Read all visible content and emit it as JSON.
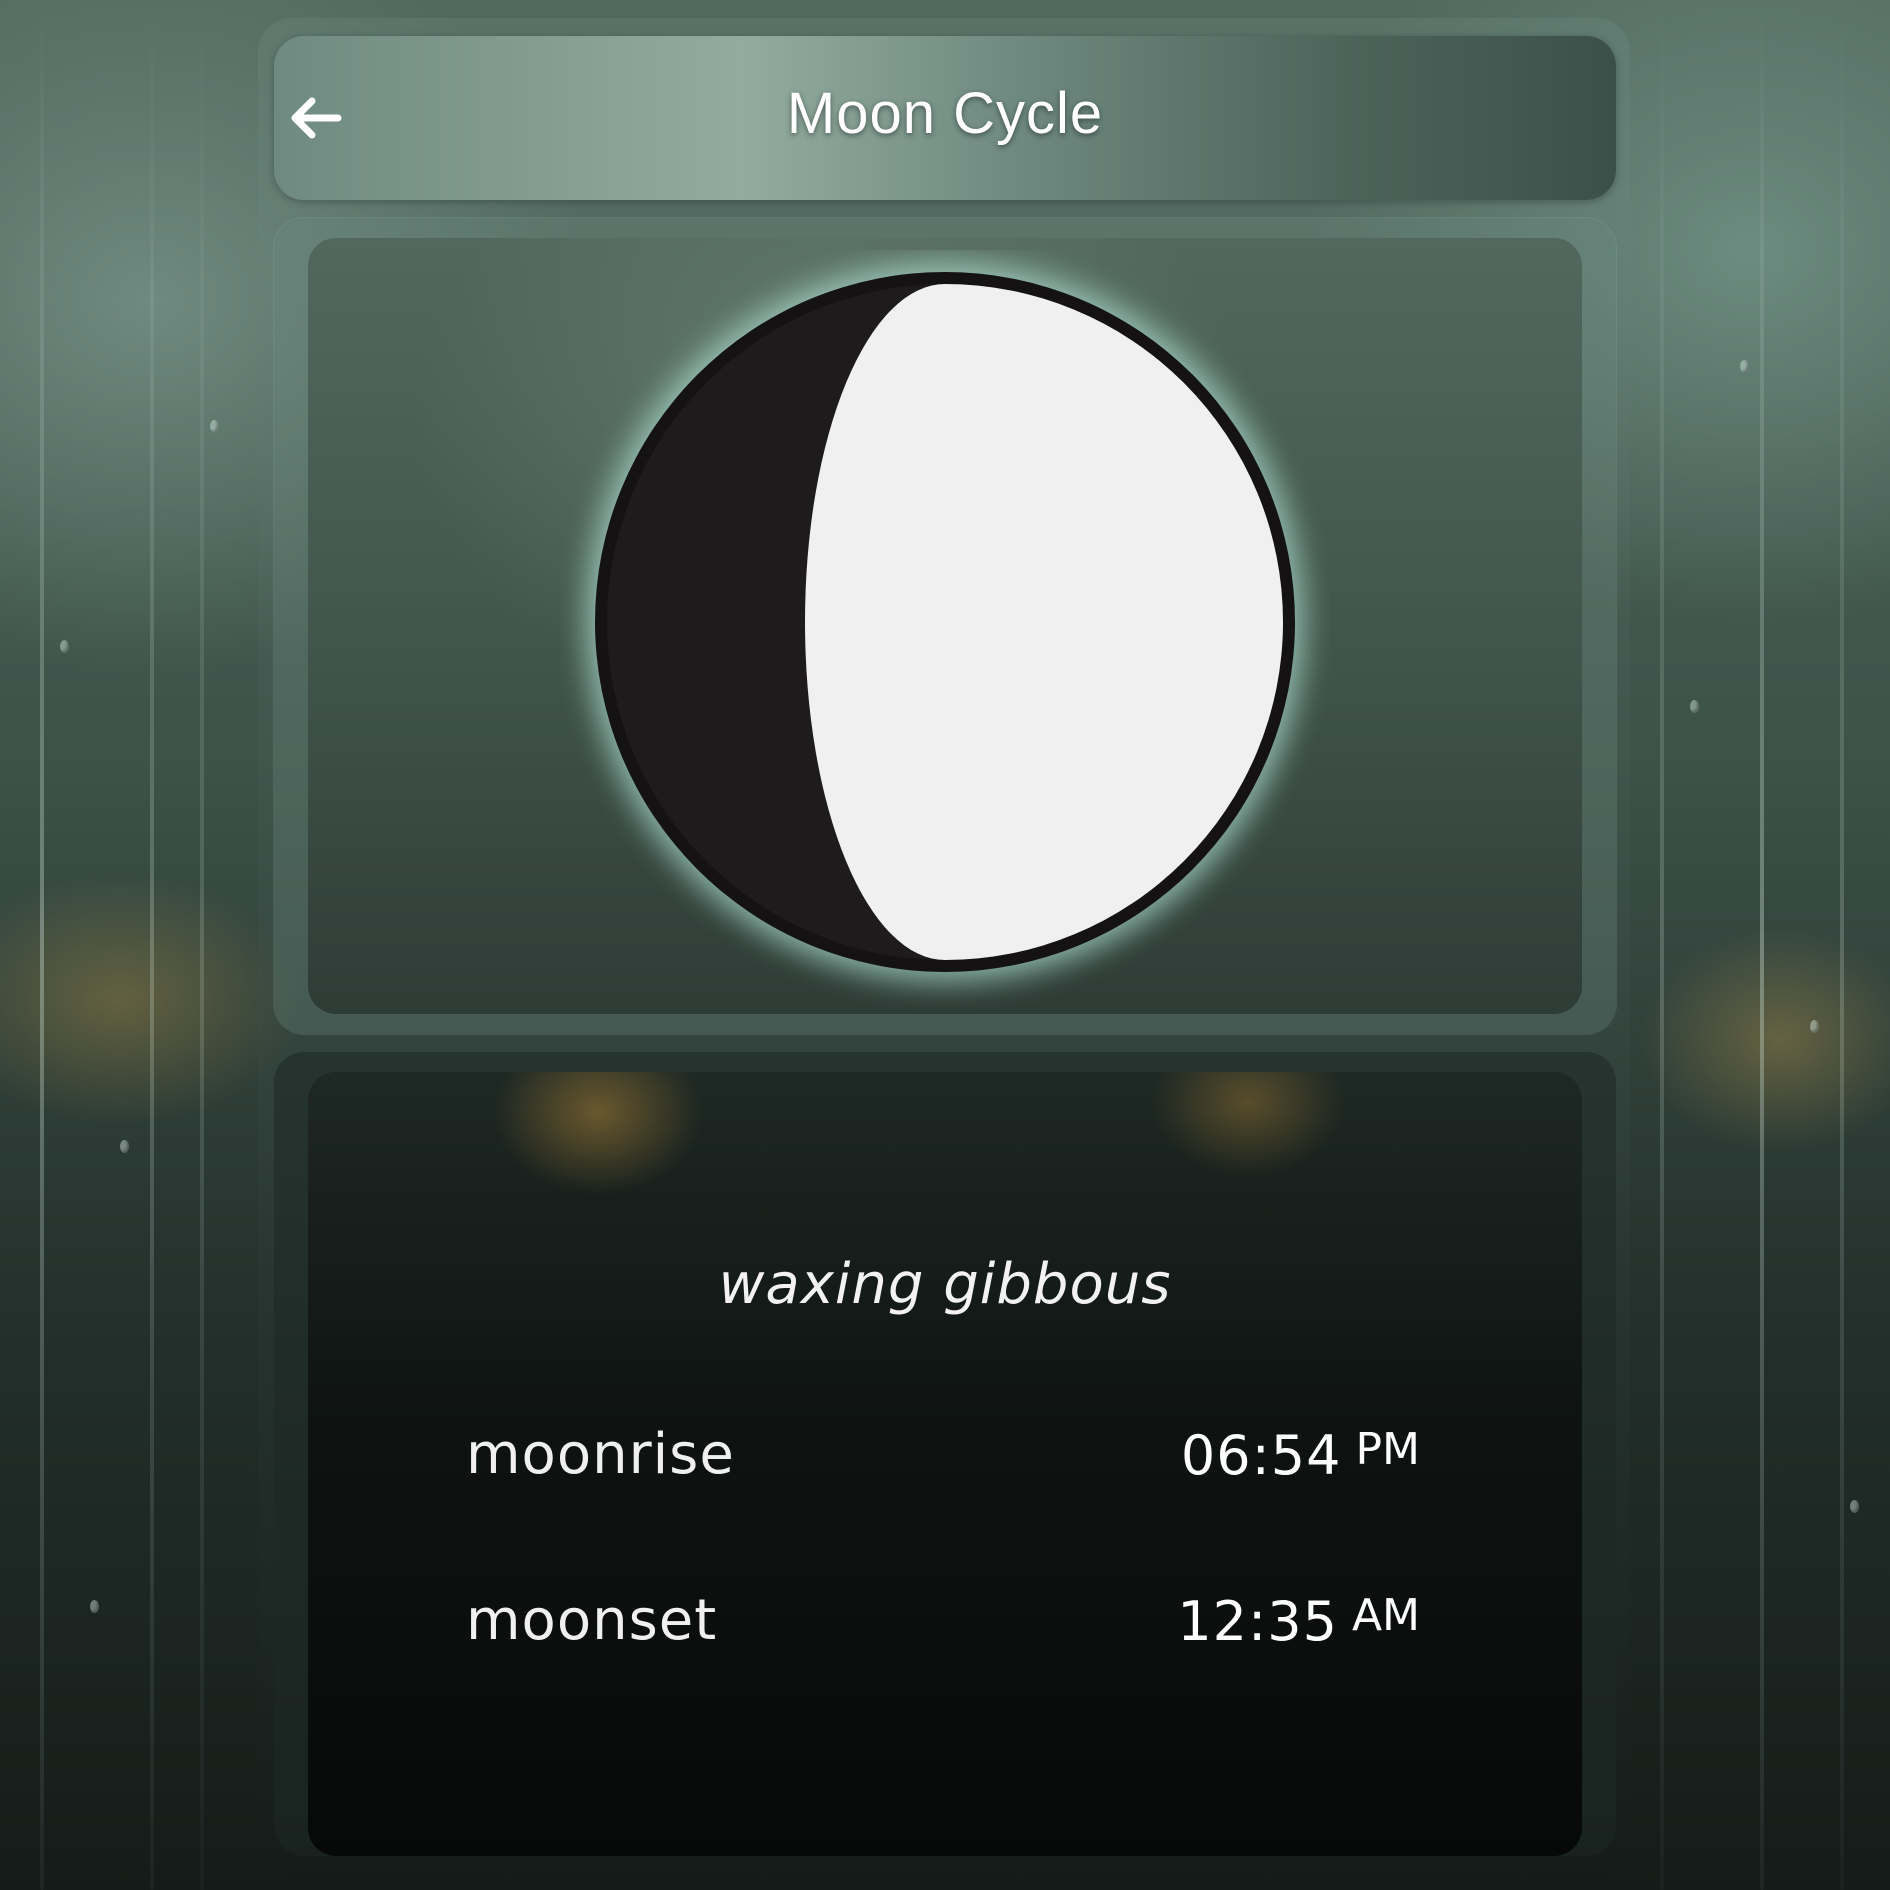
{
  "header": {
    "title": "Moon Cycle",
    "back_icon": "arrow-left-icon"
  },
  "moon": {
    "phase": "waxing gibbous",
    "lit_color": "#f0f0f0",
    "dark_color": "#1e1b1c",
    "glow_color": "#a8d8c8"
  },
  "times": {
    "moonrise": {
      "label": "moonrise",
      "time": "06:54",
      "period": "PM"
    },
    "moonset": {
      "label": "moonset",
      "time": "12:35",
      "period": "AM"
    }
  }
}
